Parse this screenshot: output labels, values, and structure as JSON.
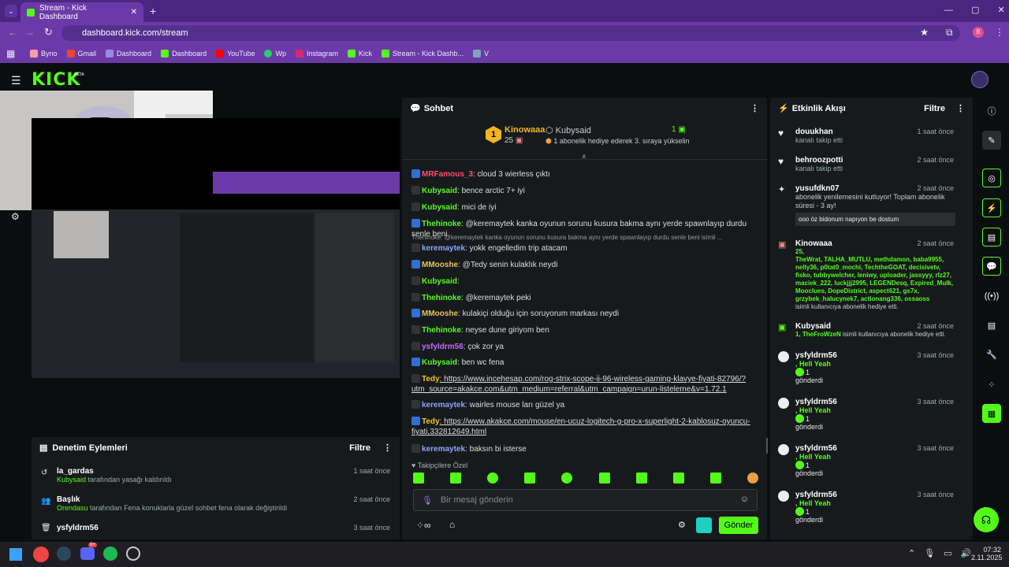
{
  "browser": {
    "tab_title": "Stream - Kick Dashboard",
    "url": "dashboard.kick.com/stream",
    "bookmarks": [
      "Byno",
      "Gmail",
      "Dashboard",
      "Dashboard",
      "YouTube",
      "Wp",
      "Instagram",
      "Kick",
      "Stream - Kick Dashb...",
      "V"
    ]
  },
  "app": {
    "logo": "KICK",
    "beta": "BETA"
  },
  "chat": {
    "title": "Sohbet",
    "top_gifter": "Kinowaaa",
    "top_gifter_count": "25",
    "sub_user": "Kubysaid",
    "sub_text": "1 abonelik hediye ederek 3. sıraya yükselin",
    "sub_count": "1",
    "lines": [
      {
        "user": "MRFamous_3",
        "color": "#ff4d6d",
        "text": ": cloud 3 wierless çıktı"
      },
      {
        "user": "Kubysaid",
        "color": "#53fc18",
        "text": ": bence arctic 7+ iyi"
      },
      {
        "user": "Kubysaid",
        "color": "#53fc18",
        "text": ": mici de iyi"
      },
      {
        "user": "Thehinoke",
        "color": "#53fc18",
        "text": ": @keremaytek kanka oyunun sorunu kusura bakma aynı yerde spawnlayıp durdu senle beni"
      },
      {
        "user": "",
        "color": "#999",
        "text": "Thehinoke: @keremaytek kanka oyunun sorunu kusura bakma aynı yerde spawnlayıp durdu senle beni isimli ..."
      },
      {
        "user": "keremaytek",
        "color": "#8aa4ff",
        "text": ": yokk engelledim trip atacam"
      },
      {
        "user": "MMooshe",
        "color": "#e5c55a",
        "text": ": @Tedy senin kulaklık neydi"
      },
      {
        "user": "Kubysaid",
        "color": "#53fc18",
        "text": ":"
      },
      {
        "user": "Thehinoke",
        "color": "#53fc18",
        "text": ": @keremaytek peki"
      },
      {
        "user": "MMooshe",
        "color": "#e5c55a",
        "text": ": kulakiçi olduğu için soruyorum markası neydi"
      },
      {
        "user": "Thehinoke",
        "color": "#53fc18",
        "text": ": neyse dune giriyom ben"
      },
      {
        "user": "ysfyldrm56",
        "color": "#c06cff",
        "text": ": çok zor ya"
      },
      {
        "user": "Kubysaid",
        "color": "#53fc18",
        "text": ": ben wc fena"
      },
      {
        "user": "Tedy",
        "color": "#f0c419",
        "text": ": https://www.incehesap.com/rog-strix-scope-ii-96-wireless-gaming-klavye-fiyati-82796/?utm_source=akakce.com&utm_medium=referral&utm_campaign=urun-listeleme&v=1.72.1"
      },
      {
        "user": "keremaytek",
        "color": "#8aa4ff",
        "text": ": wairles mouse ları güzel ya"
      },
      {
        "user": "Tedy",
        "color": "#f0c419",
        "text": ": https://www.akakce.com/mouse/en-ucuz-logitech-g-pro-x-superlight-2-kablosuz-oyuncu-fiyati,332812649.html"
      },
      {
        "user": "keremaytek",
        "color": "#8aa4ff",
        "text": ": baksın bi isterse"
      }
    ],
    "followers_only": "Takipçilere Özel",
    "placeholder": "Bir mesaj gönderin",
    "send": "Gönder"
  },
  "moderation": {
    "title": "Denetim Eylemleri",
    "filter": "Filtre",
    "items": [
      {
        "name": "la_gardas",
        "by": "Kubysaid",
        "text": " tarafından yasağı kaldırıldı",
        "time": "1 saat önce"
      },
      {
        "name": "Başlık",
        "by": "Orendasu",
        "text": " tarafından Fena konuklarla güzel sohbet fena olarak değiştirildi",
        "time": "2 saat önce"
      },
      {
        "name": "ysfyldrm56",
        "by": "",
        "text": "",
        "time": "3 saat önce"
      }
    ]
  },
  "activity": {
    "title": "Etkinlik Akışı",
    "filter": "Filtre",
    "items": [
      {
        "name": "douukhan",
        "text": "kanalı takip etti",
        "time": "1 saat önce"
      },
      {
        "name": "behroozpotti",
        "text": "kanalı takip etti",
        "time": "2 saat önce"
      },
      {
        "name": "yusufdkn07",
        "text": "abonelik yenilemesini kutluyor! Toplam abonelik süresi - 3 ay!",
        "msg": "ooo öz bidonum napıyon be dostum",
        "time": "2 saat önce"
      },
      {
        "name": "Kinowaaa",
        "count": "25,",
        "gifted": "TheWrat, TALHA_MUTLU, methdamon, baba9955, nelly36, p0tat0_mochi, TechtheGOAT, decisivetv, fisko, tubbywelcher, leniwy, uploader, jassyyy, rlz27, maciek_222, luckjjj2995, LEGENDesq, Expired_Mulk, Mooclues, DopeDistrict, aspect621, gs7x, grzybek_halucynek7, actionang336, ossaoss",
        "text": "isimli kullanıcıya abonelik hediye etti.",
        "time": "2 saat önce"
      },
      {
        "name": "Kubysaid",
        "count": "1,",
        "gifted": "TheFroWzeN",
        "text": "isimli kullanıcıya abonelik hediye etti.",
        "time": "2 saat önce"
      },
      {
        "name": "ysfyldrm56",
        "hey": ", Hell Yeah",
        "n": "1",
        "text": "gönderdi",
        "time": "3 saat önce"
      },
      {
        "name": "ysfyldrm56",
        "hey": ", Hell Yeah",
        "n": "1",
        "text": "gönderdi",
        "time": "3 saat önce"
      },
      {
        "name": "ysfyldrm56",
        "hey": ", Hell Yeah",
        "n": "1",
        "text": "gönderdi",
        "time": "3 saat önce"
      },
      {
        "name": "ysfyldrm56",
        "hey": ", Hell Yeah",
        "n": "1",
        "text": "gönderdi",
        "time": "3 saat önce"
      }
    ]
  },
  "taskbar": {
    "time": "07:32",
    "date": "2.11.2025",
    "badge": "9+"
  }
}
